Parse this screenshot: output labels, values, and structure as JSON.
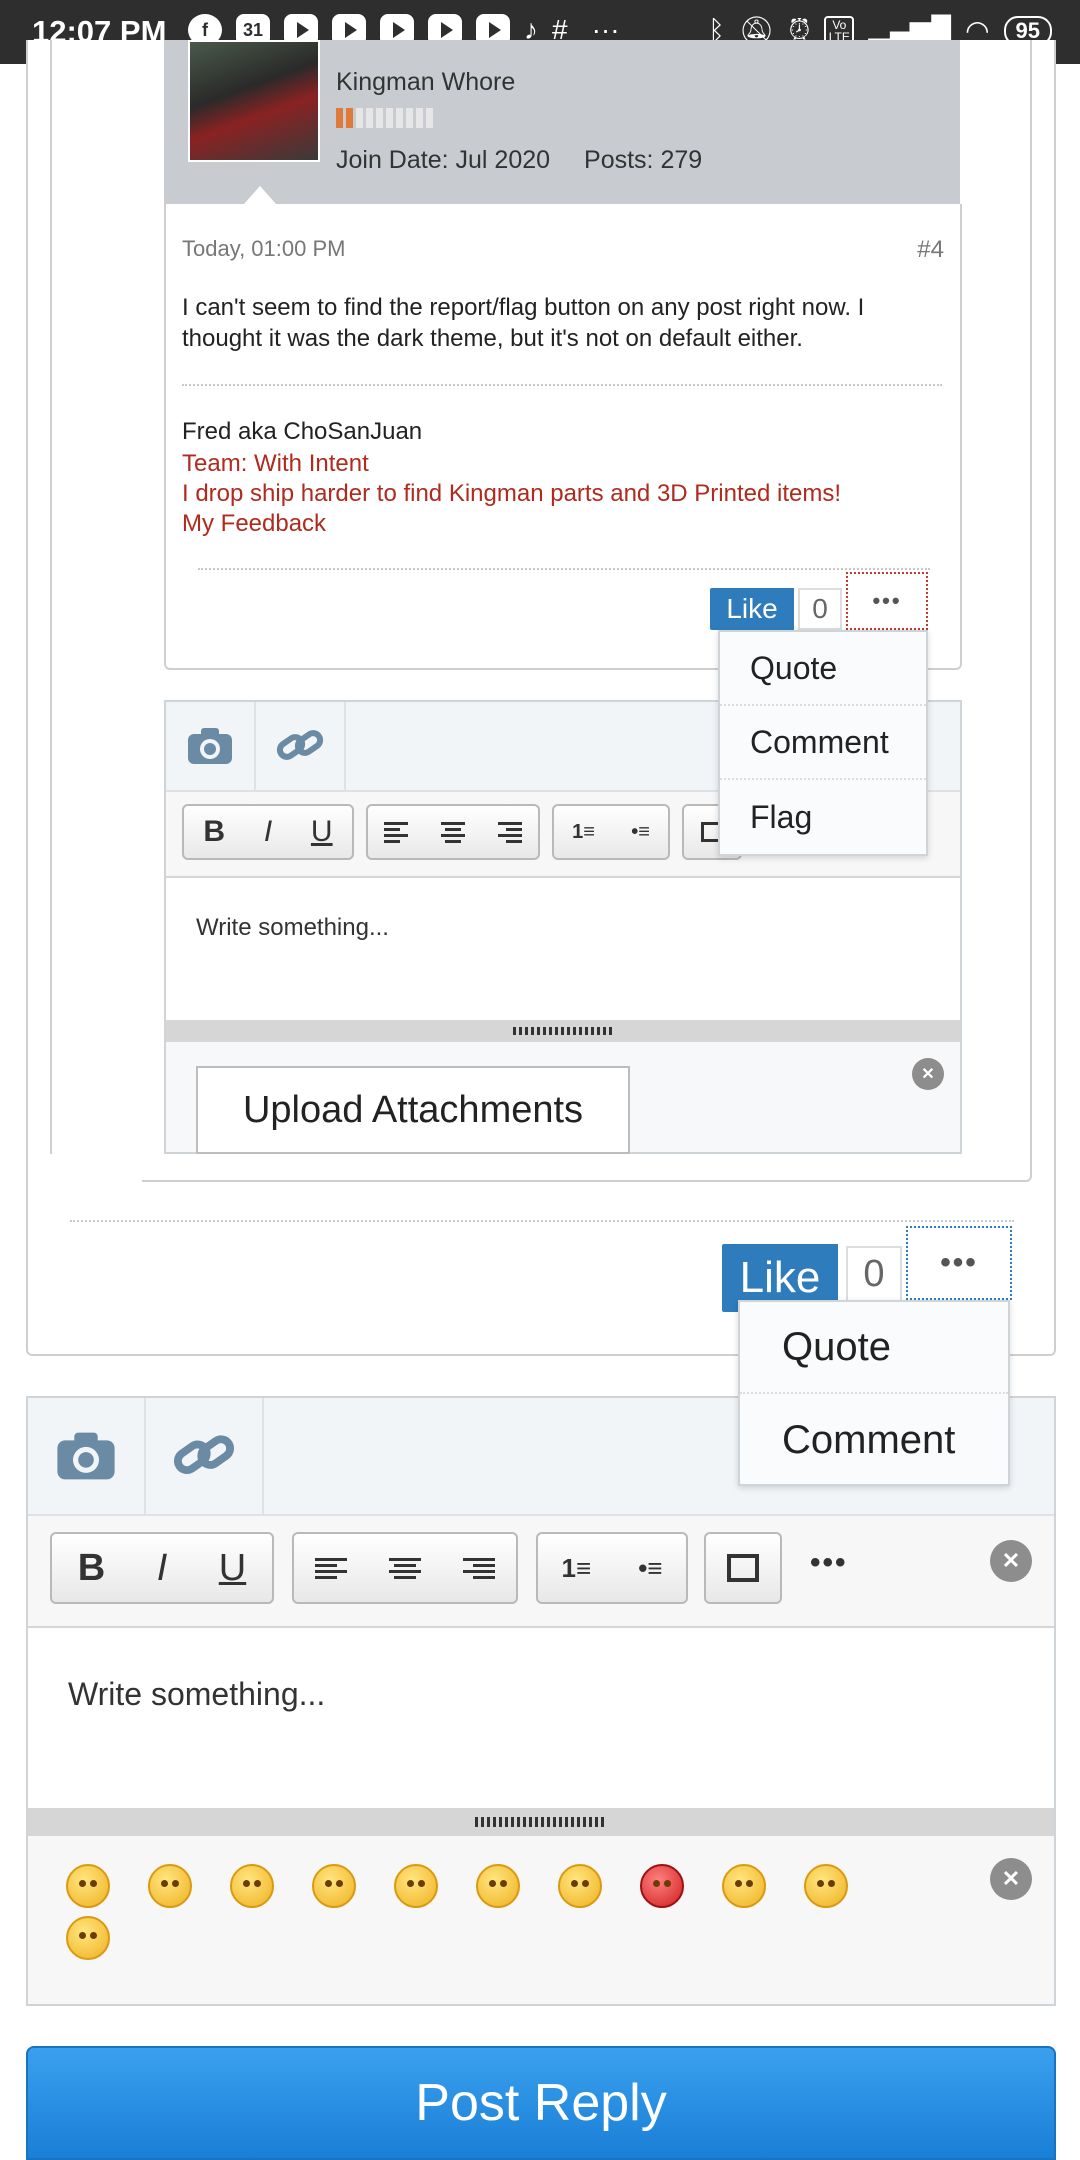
{
  "status_bar": {
    "time": "12:07 PM",
    "battery": "95",
    "calendar_day": "31",
    "more": "···",
    "volte": "Vo LTE",
    "icons": [
      "facebook-icon",
      "calendar-icon",
      "youtube-icon",
      "youtube-icon",
      "youtube-icon",
      "youtube-icon",
      "youtube-icon",
      "tiktok-icon",
      "slack-icon",
      "bluetooth-icon",
      "mute-icon",
      "alarm-icon",
      "volte-icon",
      "signal-icon",
      "wifi-icon",
      "battery-icon"
    ]
  },
  "quoted_post": {
    "user_title": "Kingman Whore",
    "join_date": "Join Date: Jul 2020",
    "posts": "Posts: 279",
    "reputation_level": 0.2,
    "date": "Today, 01:00 PM",
    "post_number": "#4",
    "body": "I can't seem to find the report/flag button on any post right now. I thought it was the dark theme, but it's not on default either.",
    "signature": {
      "name": "Fred aka ChoSanJuan",
      "links": [
        "Team: With Intent",
        "I drop ship harder to find Kingman parts and 3D Printed items!",
        "My Feedback"
      ]
    },
    "like_label": "Like",
    "like_count": "0",
    "more_label": "•••",
    "menu": [
      "Quote",
      "Comment",
      "Flag"
    ],
    "editor": {
      "placeholder": "Write something...",
      "upload_label": "Upload Attachments"
    }
  },
  "outer_post": {
    "like_label": "Like",
    "like_count": "0",
    "more_label": "•••",
    "menu": [
      "Quote",
      "Comment"
    ]
  },
  "reply_editor": {
    "toolbar": {
      "bold": "B",
      "italic": "I",
      "underline": "U",
      "more": "•••",
      "close": "✕"
    },
    "placeholder": "Write something...",
    "emojis": [
      "smile",
      "worried",
      "grin",
      "smirk",
      "happy",
      "tongue",
      "wink",
      "angry",
      "rolleyes",
      "cool",
      "shocked"
    ]
  },
  "post_reply_label": "Post Reply",
  "colors": {
    "accent": "#2f7cbd",
    "signature_link": "#b02a1d",
    "post_reply_top": "#3aa0ee",
    "post_reply_bottom": "#1a7fd6"
  }
}
